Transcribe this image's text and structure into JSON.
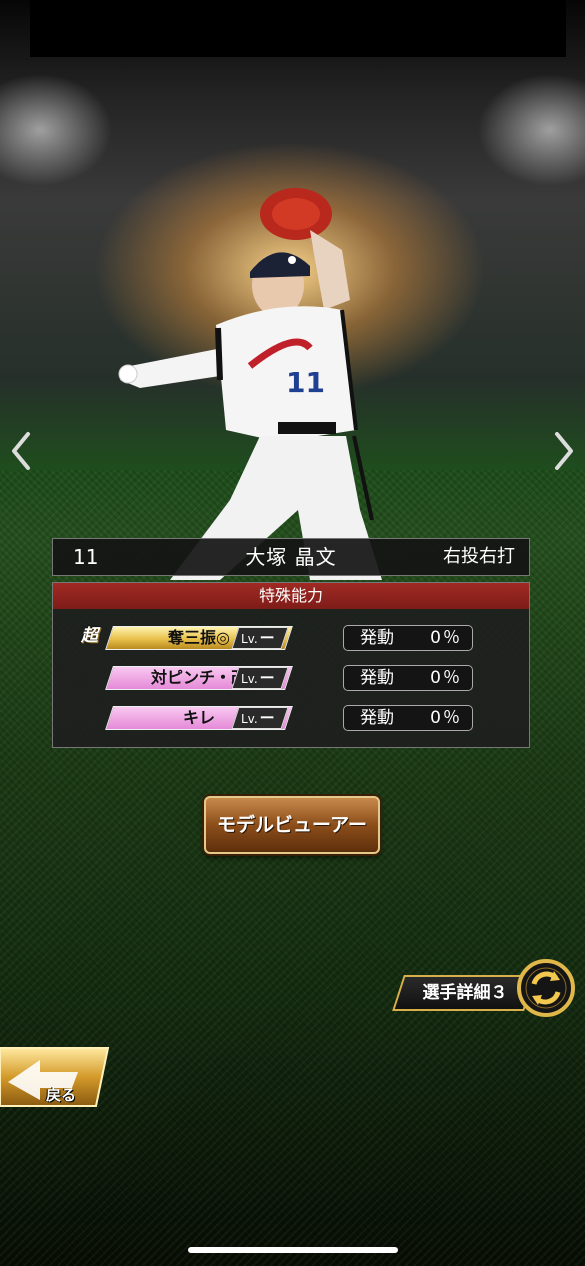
{
  "player": {
    "number": "11",
    "name": "大塚 晶文",
    "handedness": "右投右打",
    "jersey_number": "11"
  },
  "abilities_panel": {
    "header": "特殊能力",
    "lv_prefix": "Lv.",
    "items": [
      {
        "name": "奪三振◎",
        "badge": "超",
        "style": "gold",
        "level": "ー",
        "act_label": "発動",
        "act_value": "0％"
      },
      {
        "name": "対ピンチ・改",
        "badge": "",
        "style": "pink",
        "level": "ー",
        "act_label": "発動",
        "act_value": "0％"
      },
      {
        "name": "キレ",
        "badge": "",
        "style": "pink",
        "level": "ー",
        "act_label": "発動",
        "act_value": "0％"
      }
    ]
  },
  "buttons": {
    "model_viewer": "モデルビューアー",
    "player_detail": "選手詳細３",
    "back": "戻る"
  },
  "nav": {
    "prev_icon": "chevron-left-icon",
    "next_icon": "chevron-right-icon"
  },
  "colors": {
    "header_red": "#8f221d",
    "gold": "#e8c04a",
    "pink": "#e58ad8"
  }
}
